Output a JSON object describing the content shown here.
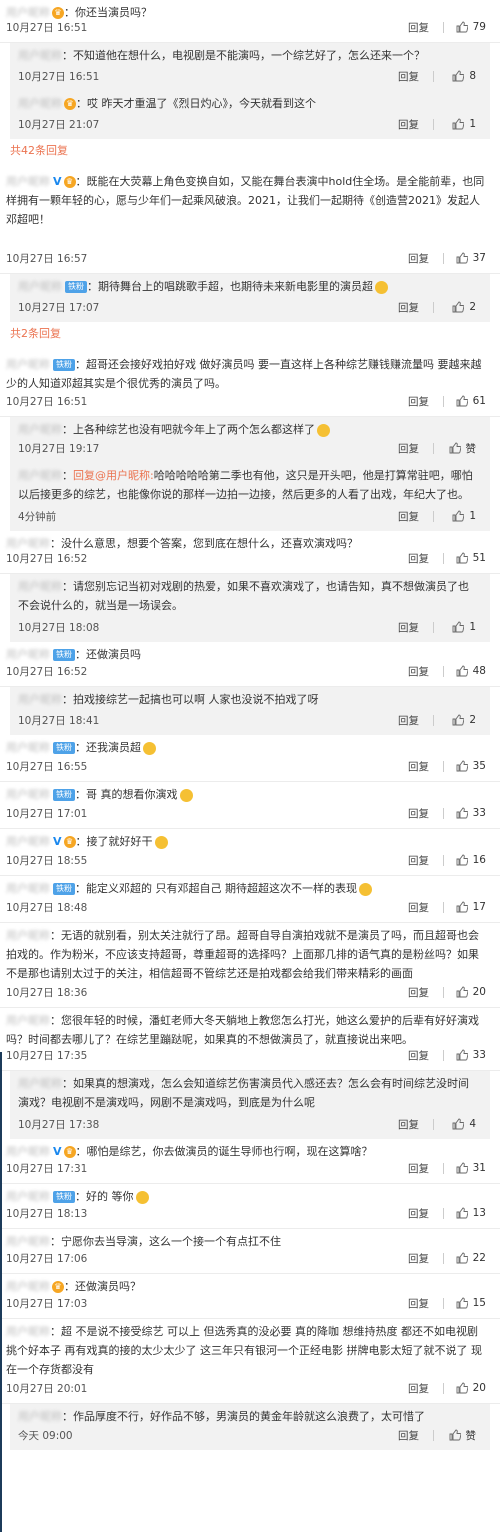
{
  "comments": [
    {
      "id": "c1",
      "type": "main",
      "user": "用户昵称",
      "badges": [
        "vip"
      ],
      "text": "你还当演员吗？",
      "emoji": false,
      "time": "10月27日 16:51",
      "reply_label": "回复",
      "likes": "79",
      "height": 42
    },
    {
      "id": "c2",
      "type": "reply",
      "user": "用户昵称",
      "text": "不知道他在想什么，电视剧是不能演吗，一个综艺好了，怎么还来一个？",
      "time": "10月27日 16:51",
      "reply_label": "回复",
      "likes": "8",
      "height": 48
    },
    {
      "id": "c3",
      "type": "reply",
      "user": "用户昵称",
      "badges": [
        "vip"
      ],
      "text": "哎 昨天才重温了《烈日灼心》，今天就看到这个",
      "time": "10月27日 21:07",
      "reply_label": "回复",
      "likes": "1",
      "height": 48
    },
    {
      "id": "m1",
      "type": "more",
      "text": "共42条回复",
      "height": 30
    },
    {
      "id": "c4",
      "type": "main",
      "user": "用户昵称",
      "badges": [
        "v",
        "vip"
      ],
      "text": "既能在大荧幕上角色变换自如，又能在舞台表演中hold住全场。是全能前辈，也同样拥有一颗年轻的心，愿与少年们一起乘风破浪。2021，让我们一起期待《创造营2021》发起人邓超吧！",
      "time": "10月27日 16:57",
      "reply_label": "回复",
      "likes": "37",
      "height": 104
    },
    {
      "id": "c5",
      "type": "reply",
      "user": "用户昵称",
      "badges": [
        "fan"
      ],
      "text": "期待舞台上的唱跳歌手超，也期待未来新电影里的演员超",
      "emoji": true,
      "time": "10月27日 17:07",
      "reply_label": "回复",
      "likes": "2",
      "height": 48
    },
    {
      "id": "m2",
      "type": "more",
      "text": "共2条回复",
      "height": 30
    },
    {
      "id": "c6",
      "type": "main",
      "user": "用户昵称",
      "badges": [
        "fan"
      ],
      "text": "超哥还会接好戏拍好戏 做好演员吗 要一直这样上各种综艺赚钱赚流量吗 要越来越少的人知道邓超其实是个很优秀的演员了吗。",
      "time": "10月27日 16:51",
      "reply_label": "回复",
      "likes": "61",
      "height": 64
    },
    {
      "id": "c7",
      "type": "reply",
      "user": "用户昵称",
      "text": "上各种综艺也没有吧就今年上了两个怎么都这样了",
      "emoji": true,
      "time": "10月27日 19:17",
      "reply_label": "回复",
      "likes": "赞",
      "height": 46
    },
    {
      "id": "c8",
      "type": "reply",
      "user": "用户昵称",
      "quote": "回复@用户昵称:",
      "text": "哈哈哈哈哈第二季也有他，这只是开头吧，他是打算常驻吧，哪怕以后接更多的综艺，也能像你说的那样一边拍一边接，然后更多的人看了出戏，年纪大了也。",
      "time": "4分钟前",
      "reply_label": "回复",
      "likes": "1",
      "height": 68
    },
    {
      "id": "c9",
      "type": "main",
      "user": "用户昵称",
      "text": "没什么意思，想要个答案，您到底在想什么，还喜欢演戏吗？",
      "time": "10月27日 16:52",
      "reply_label": "回复",
      "likes": "51",
      "height": 42
    },
    {
      "id": "c10",
      "type": "reply",
      "user": "用户昵称",
      "text": "请您别忘记当初对戏剧的热爱，如果不喜欢演戏了，也请告知，真不想做演员了也不会说什么的，就当是一场误会。",
      "time": "10月27日 18:08",
      "reply_label": "回复",
      "likes": "1",
      "height": 68
    },
    {
      "id": "c11",
      "type": "main",
      "user": "用户昵称",
      "badges": [
        "fan"
      ],
      "text": "还做演员吗",
      "time": "10月27日 16:52",
      "reply_label": "回复",
      "likes": "48",
      "height": 44
    },
    {
      "id": "c12",
      "type": "reply",
      "user": "用户昵称",
      "text": "拍戏接综艺一起搞也可以啊 人家也没说不拍戏了呀",
      "time": "10月27日 18:41",
      "reply_label": "回复",
      "likes": "2",
      "height": 48
    },
    {
      "id": "c13",
      "type": "main",
      "user": "用户昵称",
      "badges": [
        "fan"
      ],
      "text": "还我演员超",
      "emoji": true,
      "time": "10月27日 16:55",
      "reply_label": "回复",
      "likes": "35",
      "height": 46
    },
    {
      "id": "c14",
      "type": "main",
      "user": "用户昵称",
      "badges": [
        "fan"
      ],
      "text": "哥 真的想看你演戏",
      "emoji": true,
      "time": "10月27日 17:01",
      "reply_label": "回复",
      "likes": "33",
      "height": 46
    },
    {
      "id": "c15",
      "type": "main",
      "user": "用户昵称",
      "badges": [
        "v",
        "vip"
      ],
      "text": "接了就好好干",
      "emoji": true,
      "time": "10月27日 18:55",
      "reply_label": "回复",
      "likes": "16",
      "height": 46
    },
    {
      "id": "c16",
      "type": "main",
      "user": "用户昵称",
      "badges": [
        "fan"
      ],
      "text": "能定义邓超的 只有邓超自己 期待超超这次不一样的表现",
      "emoji": true,
      "time": "10月27日 18:48",
      "reply_label": "回复",
      "likes": "17",
      "height": 46
    },
    {
      "id": "c17",
      "type": "main",
      "user": "用户昵称",
      "text": "无语的就别看，别太关注就行了昂。超哥自导自演拍戏就不是演员了吗，而且超哥也会拍戏的。作为粉米，不应该支持超哥，尊重超哥的选择吗？上面那几排的语气真的是粉丝吗？如果不是那也请别太过于的关注，相信超哥不管综艺还是拍戏都会给我们带来精彩的画面",
      "time": "10月27日 18:36",
      "reply_label": "回复",
      "likes": "20",
      "height": 84
    },
    {
      "id": "c18",
      "type": "main",
      "user": "用户昵称",
      "text": "您很年轻的时候，潘虹老师大冬天躺地上教您怎么打光，她这么爱护的后辈有好好演戏吗？时间都去哪儿了？在综艺里蹦跶呢，如果真的不想做演员了，就直接说出来吧。",
      "time": "10月27日 17:35",
      "reply_label": "回复",
      "likes": "33",
      "height": 62
    },
    {
      "id": "c19",
      "type": "reply",
      "user": "用户昵称",
      "text": "如果真的想演戏，怎么会知道综艺伤害演员代入感还去？怎么会有时间综艺没时间演戏？电视剧不是演戏吗，网剧不是演戏吗，到底是为什么呢",
      "time": "10月27日 17:38",
      "reply_label": "回复",
      "likes": "4",
      "height": 68
    },
    {
      "id": "c20",
      "type": "main",
      "user": "用户昵称",
      "badges": [
        "v",
        "vip"
      ],
      "text": "哪怕是综艺，你去做演员的诞生导师也行啊，现在这算啥？",
      "time": "10月27日 17:31",
      "reply_label": "回复",
      "likes": "31",
      "height": 44
    },
    {
      "id": "c21",
      "type": "main",
      "user": "用户昵称",
      "badges": [
        "fan"
      ],
      "text": "好的 等你",
      "emoji": true,
      "time": "10月27日 18:13",
      "reply_label": "回复",
      "likes": "13",
      "height": 44
    },
    {
      "id": "c22",
      "type": "main",
      "user": "用户昵称",
      "text": "宁愿你去当导演，这么一个接一个有点扛不住",
      "time": "10月27日 17:06",
      "reply_label": "回复",
      "likes": "22",
      "height": 44
    },
    {
      "id": "c23",
      "type": "main",
      "user": "用户昵称",
      "badges": [
        "vip"
      ],
      "text": "还做演员吗？",
      "time": "10月27日 17:03",
      "reply_label": "回复",
      "likes": "15",
      "height": 44
    },
    {
      "id": "c24",
      "type": "main",
      "user": "用户昵称",
      "text": "超 不是说不接受综艺 可以上 但选秀真的没必要 真的降咖 想维持热度 都还不如电视剧挑个好本子 再有戏真的接的太少太少了 这三年只有银河一个正经电影 拼牌电影太短了就不说了 现在一个存货都没有",
      "time": "10月27日 20:01",
      "reply_label": "回复",
      "likes": "20",
      "height": 84
    },
    {
      "id": "c25",
      "type": "reply",
      "user": "用户昵称",
      "text": "作品厚度不行，好作品不够，男演员的黄金年龄就这么浪费了，太可惜了",
      "time": "今天 09:00",
      "reply_label": "回复",
      "likes": "赞",
      "height": 46
    }
  ]
}
